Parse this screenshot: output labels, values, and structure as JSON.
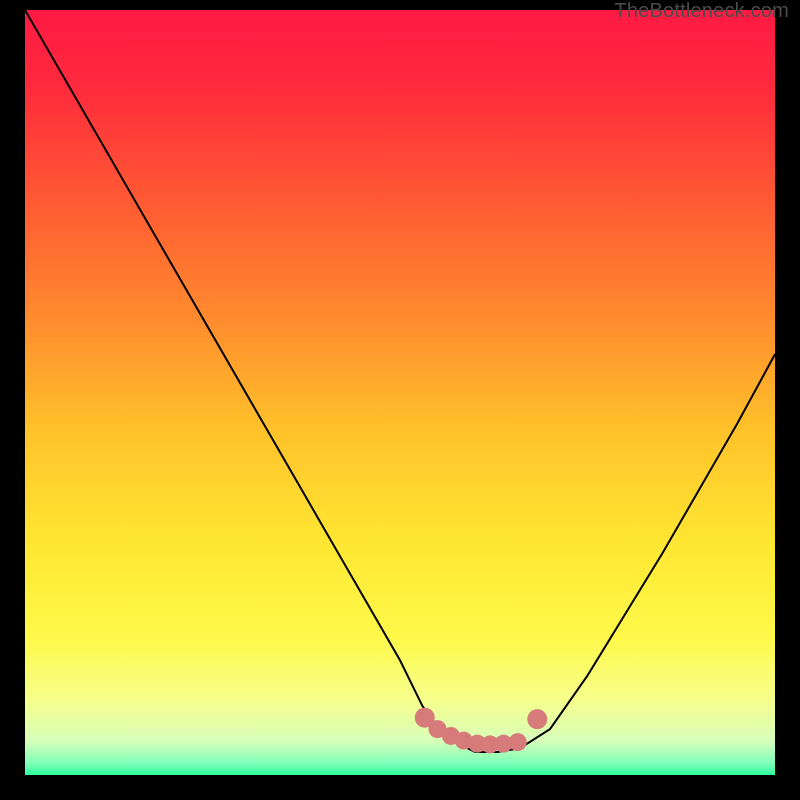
{
  "watermark": {
    "text": "TheBottleneck.com"
  },
  "colors": {
    "bg_black": "#000000",
    "gradient_stops": [
      {
        "offset": 0,
        "color": "#ff1a44"
      },
      {
        "offset": 0.1,
        "color": "#ff2a3d"
      },
      {
        "offset": 0.25,
        "color": "#ff5a33"
      },
      {
        "offset": 0.4,
        "color": "#ff8a2e"
      },
      {
        "offset": 0.55,
        "color": "#ffc22a"
      },
      {
        "offset": 0.7,
        "color": "#ffe733"
      },
      {
        "offset": 0.82,
        "color": "#fff94a"
      },
      {
        "offset": 0.9,
        "color": "#f6ff8a"
      },
      {
        "offset": 0.955,
        "color": "#d8ffba"
      },
      {
        "offset": 0.985,
        "color": "#7dffb9"
      },
      {
        "offset": 1.0,
        "color": "#2bff9b"
      }
    ],
    "curve_stroke": "#000000",
    "marker_fill": "#d67a7a"
  },
  "chart_data": {
    "type": "line",
    "title": "",
    "xlabel": "",
    "ylabel": "",
    "x": [
      0,
      5,
      10,
      15,
      20,
      25,
      30,
      35,
      40,
      45,
      50,
      53,
      56,
      60,
      63,
      66,
      70,
      75,
      80,
      85,
      90,
      95,
      100
    ],
    "values": [
      100,
      91.5,
      83,
      74.5,
      66,
      57.5,
      49,
      40.5,
      32,
      23.5,
      15,
      9,
      5,
      3,
      3,
      3.5,
      6,
      13,
      21,
      29,
      37.5,
      46,
      55
    ],
    "xlim": [
      0,
      100
    ],
    "ylim": [
      0,
      100
    ],
    "markers": {
      "x": [
        53.3,
        55.0,
        56.8,
        58.5,
        60.3,
        62.0,
        63.8,
        65.7,
        68.3
      ],
      "values": [
        7.5,
        6.0,
        5.1,
        4.5,
        4.1,
        4.0,
        4.1,
        4.3,
        7.3
      ]
    },
    "gradient_meaning": "background vertical gradient: red (top, high bottleneck) → green (bottom, optimal)"
  }
}
